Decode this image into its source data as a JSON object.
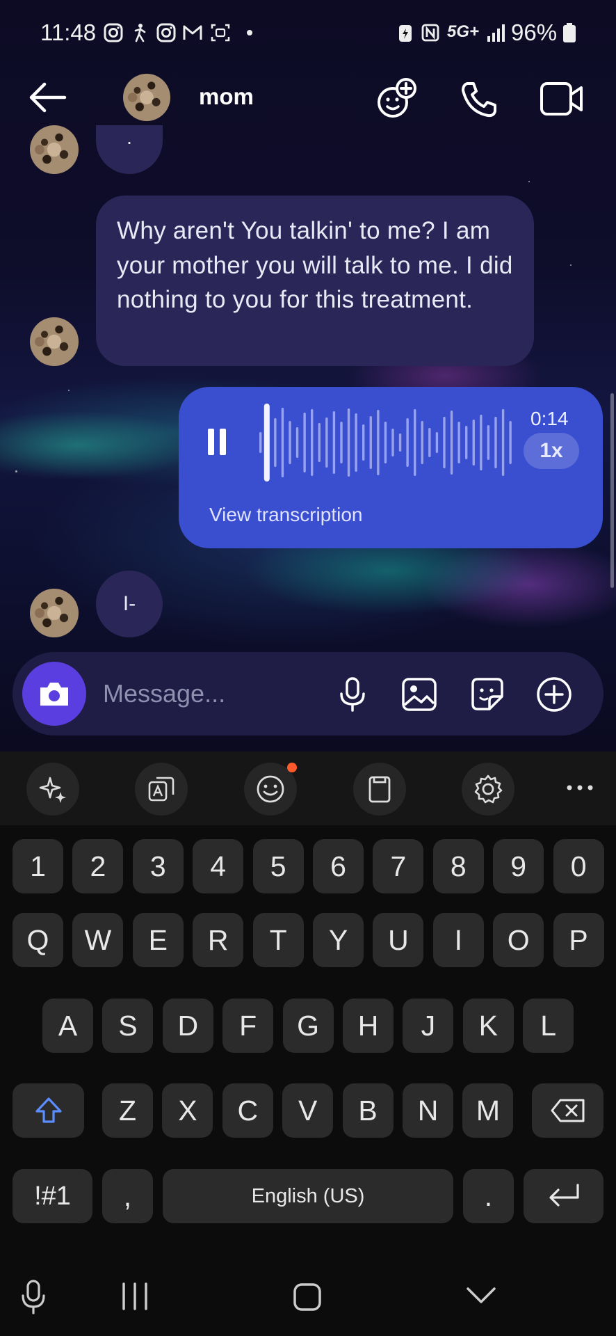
{
  "status_bar": {
    "time": "11:48",
    "network": "5G+",
    "battery": "96%"
  },
  "header": {
    "contact_name": "mom",
    "icons": [
      "back-arrow-icon",
      "add-effect-icon",
      "phone-icon",
      "video-icon"
    ]
  },
  "messages": [
    {
      "direction": "incoming",
      "type": "text",
      "text": "Why aren't You talkin' to me? I am your mother you will talk to me. I did nothing to you for this treatment."
    },
    {
      "direction": "outgoing",
      "type": "voice",
      "duration": "0:14",
      "speed": "1x",
      "action": "View transcription",
      "progress": 0.02
    },
    {
      "direction": "incoming",
      "type": "text",
      "text": "I-"
    }
  ],
  "composer": {
    "placeholder": "Message..."
  },
  "keyboard": {
    "number_row": [
      "1",
      "2",
      "3",
      "4",
      "5",
      "6",
      "7",
      "8",
      "9",
      "0"
    ],
    "row1": [
      "Q",
      "W",
      "E",
      "R",
      "T",
      "Y",
      "U",
      "I",
      "O",
      "P"
    ],
    "row2": [
      "A",
      "S",
      "D",
      "F",
      "G",
      "H",
      "J",
      "K",
      "L"
    ],
    "row3": [
      "Z",
      "X",
      "C",
      "V",
      "B",
      "N",
      "M"
    ],
    "symbols_key": "!#1",
    "comma_key": ",",
    "space_label": "English (US)",
    "period_key": "."
  },
  "colors": {
    "accent": "#5b3ee0",
    "outgoing_bubble": "#3a4fd0",
    "incoming_bubble": "#2a2758"
  }
}
